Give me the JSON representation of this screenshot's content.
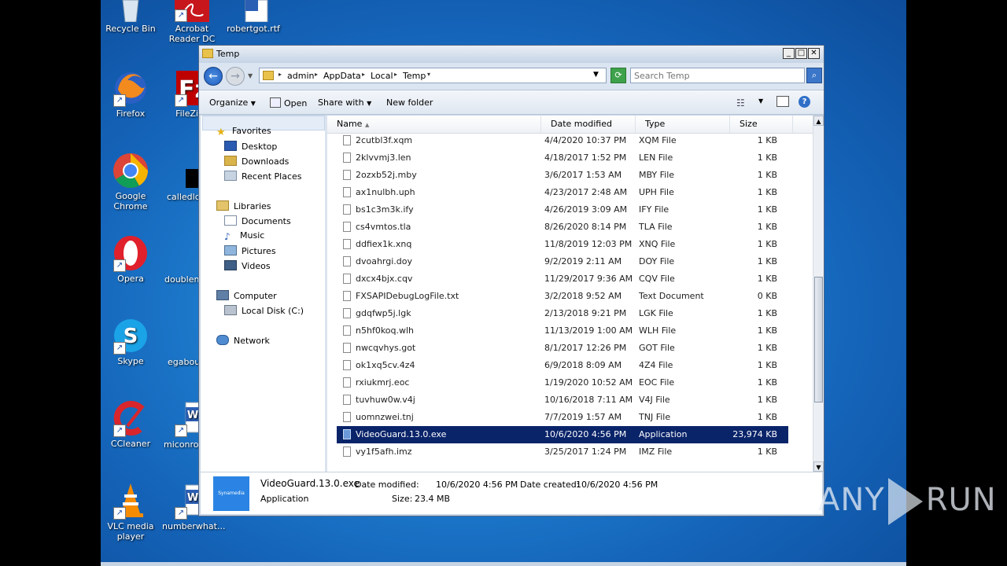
{
  "desktop": {
    "icons": [
      {
        "label": "Recycle Bin"
      },
      {
        "label": "Acrobat Reader DC"
      },
      {
        "label": "robertgot.rtf"
      },
      {
        "label": "Firefox"
      },
      {
        "label": "FileZilla"
      },
      {
        "label": "Google Chrome"
      },
      {
        "label": "calledloc"
      },
      {
        "label": "Opera"
      },
      {
        "label": "doublem"
      },
      {
        "label": "Skype"
      },
      {
        "label": "egabou"
      },
      {
        "label": "CCleaner"
      },
      {
        "label": "miconroji"
      },
      {
        "label": "VLC media player"
      },
      {
        "label": "numberwhat..."
      }
    ]
  },
  "window": {
    "title": "Temp",
    "address": {
      "crumbs": [
        "admin",
        "AppData",
        "Local",
        "Temp"
      ]
    },
    "search": {
      "placeholder": "Search Temp"
    },
    "toolbar": {
      "organize": "Organize",
      "open": "Open",
      "share_with": "Share with",
      "new_folder": "New folder"
    },
    "nav": {
      "favorites": "Favorites",
      "desktop": "Desktop",
      "downloads": "Downloads",
      "recent_places": "Recent Places",
      "libraries": "Libraries",
      "documents": "Documents",
      "music": "Music",
      "pictures": "Pictures",
      "videos": "Videos",
      "computer": "Computer",
      "local_disk": "Local Disk (C:)",
      "network": "Network"
    },
    "columns": {
      "name": "Name",
      "date_modified": "Date modified",
      "type": "Type",
      "size": "Size"
    },
    "files": [
      {
        "name": "2cutbl3f.xqm",
        "date": "4/4/2020 10:37 PM",
        "type": "XQM File",
        "size": "1 KB"
      },
      {
        "name": "2klvvmj3.len",
        "date": "4/18/2017 1:52 PM",
        "type": "LEN File",
        "size": "1 KB"
      },
      {
        "name": "2ozxb52j.mby",
        "date": "3/6/2017 1:53 AM",
        "type": "MBY File",
        "size": "1 KB"
      },
      {
        "name": "ax1nulbh.uph",
        "date": "4/23/2017 2:48 AM",
        "type": "UPH File",
        "size": "1 KB"
      },
      {
        "name": "bs1c3m3k.ify",
        "date": "4/26/2019 3:09 AM",
        "type": "IFY File",
        "size": "1 KB"
      },
      {
        "name": "cs4vmtos.tla",
        "date": "8/26/2020 8:14 PM",
        "type": "TLA File",
        "size": "1 KB"
      },
      {
        "name": "ddfiex1k.xnq",
        "date": "11/8/2019 12:03 PM",
        "type": "XNQ File",
        "size": "1 KB"
      },
      {
        "name": "dvoahrgi.doy",
        "date": "9/2/2019 2:11 AM",
        "type": "DOY File",
        "size": "1 KB"
      },
      {
        "name": "dxcx4bjx.cqv",
        "date": "11/29/2017 9:36 AM",
        "type": "CQV File",
        "size": "1 KB"
      },
      {
        "name": "FXSAPIDebugLogFile.txt",
        "date": "3/2/2018 9:52 AM",
        "type": "Text Document",
        "size": "0 KB"
      },
      {
        "name": "gdqfwp5j.lgk",
        "date": "2/13/2018 9:21 PM",
        "type": "LGK File",
        "size": "1 KB"
      },
      {
        "name": "n5hf0koq.wlh",
        "date": "11/13/2019 1:00 AM",
        "type": "WLH File",
        "size": "1 KB"
      },
      {
        "name": "nwcqvhys.got",
        "date": "8/1/2017 12:26 PM",
        "type": "GOT File",
        "size": "1 KB"
      },
      {
        "name": "ok1xq5cv.4z4",
        "date": "6/9/2018 8:09 AM",
        "type": "4Z4 File",
        "size": "1 KB"
      },
      {
        "name": "rxiukmrj.eoc",
        "date": "1/19/2020 10:52 AM",
        "type": "EOC File",
        "size": "1 KB"
      },
      {
        "name": "tuvhuw0w.v4j",
        "date": "10/16/2018 7:11 AM",
        "type": "V4J File",
        "size": "1 KB"
      },
      {
        "name": "uomnzwei.tnj",
        "date": "7/7/2019 1:57 AM",
        "type": "TNJ File",
        "size": "1 KB"
      },
      {
        "name": "VideoGuard.13.0.exe",
        "date": "10/6/2020 4:56 PM",
        "type": "Application",
        "size": "23,974 KB",
        "selected": true
      },
      {
        "name": "vy1f5afh.imz",
        "date": "3/25/2017 1:24 PM",
        "type": "IMZ File",
        "size": "1 KB"
      }
    ],
    "details": {
      "name": "VideoGuard.13.0.exe",
      "type": "Application",
      "date_modified_label": "Date modified:",
      "date_modified": "10/6/2020 4:56 PM",
      "date_created_label": "Date created:",
      "date_created": "10/6/2020 4:56 PM",
      "size_label": "Size:",
      "size": "23.4 MB",
      "thumb_text": "Synamedia"
    }
  },
  "watermark": {
    "left": "ANY",
    "right": "RUN"
  }
}
